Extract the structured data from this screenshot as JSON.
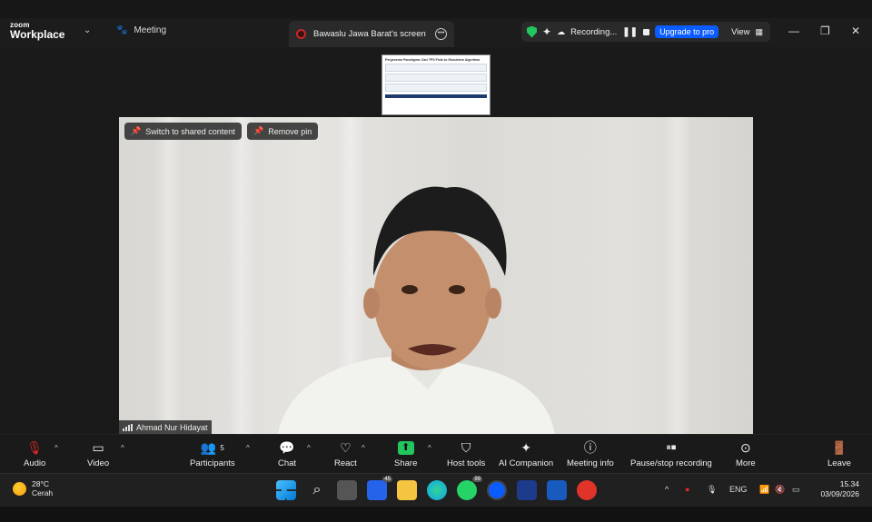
{
  "app": {
    "logo_top": "zoom",
    "logo_bottom": "Workplace"
  },
  "tabs": {
    "meeting": "Meeting",
    "share": "Bawaslu Jawa Barat's screen"
  },
  "status": {
    "recording": "Recording...",
    "upgrade": "Upgrade to pro",
    "view": "View"
  },
  "video": {
    "switch_btn": "Switch to shared content",
    "remove_pin_btn": "Remove pin",
    "participant_name": "Ahmad Nur Hidayat"
  },
  "thumbnail": {
    "title": "Pergeseran Paradigma: Dari TPS Fisik ke Ekosistem Algoritma"
  },
  "toolbar": {
    "audio": "Audio",
    "video": "Video",
    "participants": "Participants",
    "participants_count": "5",
    "chat": "Chat",
    "react": "React",
    "share": "Share",
    "host_tools": "Host tools",
    "ai_companion": "AI Companion",
    "meeting_info": "Meeting info",
    "pause_stop": "Pause/stop recording",
    "more": "More",
    "leave": "Leave"
  },
  "taskbar": {
    "temp": "28°C",
    "weather": "Cerah",
    "lang": "ENG",
    "time": "15.34",
    "date": "03/09/2026",
    "badge_a": "45",
    "badge_b": "99"
  },
  "colors": {
    "accent": "#0b5cff",
    "share_green": "#22c55e",
    "leave_red": "#e02828"
  }
}
